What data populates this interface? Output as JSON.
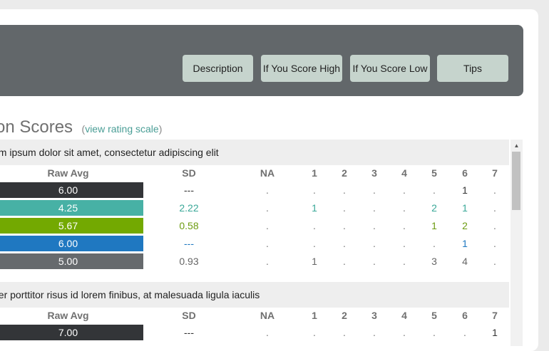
{
  "header": {
    "tabs": [
      {
        "label": "Description"
      },
      {
        "label": "If You Score High"
      },
      {
        "label": "If You Score Low"
      },
      {
        "label": "Tips"
      }
    ]
  },
  "section": {
    "title": "stion Scores",
    "scale_link": "view rating scale",
    "paren_open": "(",
    "paren_close": ")"
  },
  "columns": {
    "raw": "Raw Avg",
    "sd": "SD",
    "na": "NA",
    "r1": "1",
    "r2": "2",
    "r3": "3",
    "r4": "4",
    "r5": "5",
    "r6": "6",
    "r7": "7"
  },
  "colors": {
    "dark": "#333538",
    "teal": "#47b1a5",
    "green": "#73a901",
    "blue": "#1f78c1",
    "gray": "#666a6d",
    "dark_text": "#333333",
    "teal_text": "#3aa898",
    "green_text": "#6d9c12",
    "blue_text": "#1f78c1",
    "gray_text": "#666666"
  },
  "questions": [
    {
      "text": "em ipsum dolor sit amet, consectetur adipiscing elit",
      "rows": [
        {
          "raw": "6.00",
          "sd": "---",
          "na": ".",
          "r": [
            ".",
            ".",
            ".",
            ".",
            ".",
            "1",
            "."
          ],
          "color_key": "dark"
        },
        {
          "raw": "4.25",
          "sd": "2.22",
          "na": ".",
          "r": [
            "1",
            ".",
            ".",
            ".",
            "2",
            "1",
            "."
          ],
          "color_key": "teal"
        },
        {
          "raw": "5.67",
          "sd": "0.58",
          "na": ".",
          "r": [
            ".",
            ".",
            ".",
            ".",
            "1",
            "2",
            "."
          ],
          "color_key": "green"
        },
        {
          "raw": "6.00",
          "sd": "---",
          "na": ".",
          "r": [
            ".",
            ".",
            ".",
            ".",
            ".",
            "1",
            "."
          ],
          "color_key": "blue"
        },
        {
          "raw": "5.00",
          "sd": "0.93",
          "na": ".",
          "r": [
            "1",
            ".",
            ".",
            ".",
            "3",
            "4",
            "."
          ],
          "color_key": "gray"
        }
      ]
    },
    {
      "text": "ger porttitor risus id lorem finibus, at malesuada ligula iaculis",
      "rows": [
        {
          "raw": "7.00",
          "sd": "---",
          "na": ".",
          "r": [
            ".",
            ".",
            ".",
            ".",
            ".",
            ".",
            "1"
          ],
          "color_key": "dark"
        }
      ]
    }
  ],
  "scrollbar": {
    "up_arrow": "▲"
  }
}
